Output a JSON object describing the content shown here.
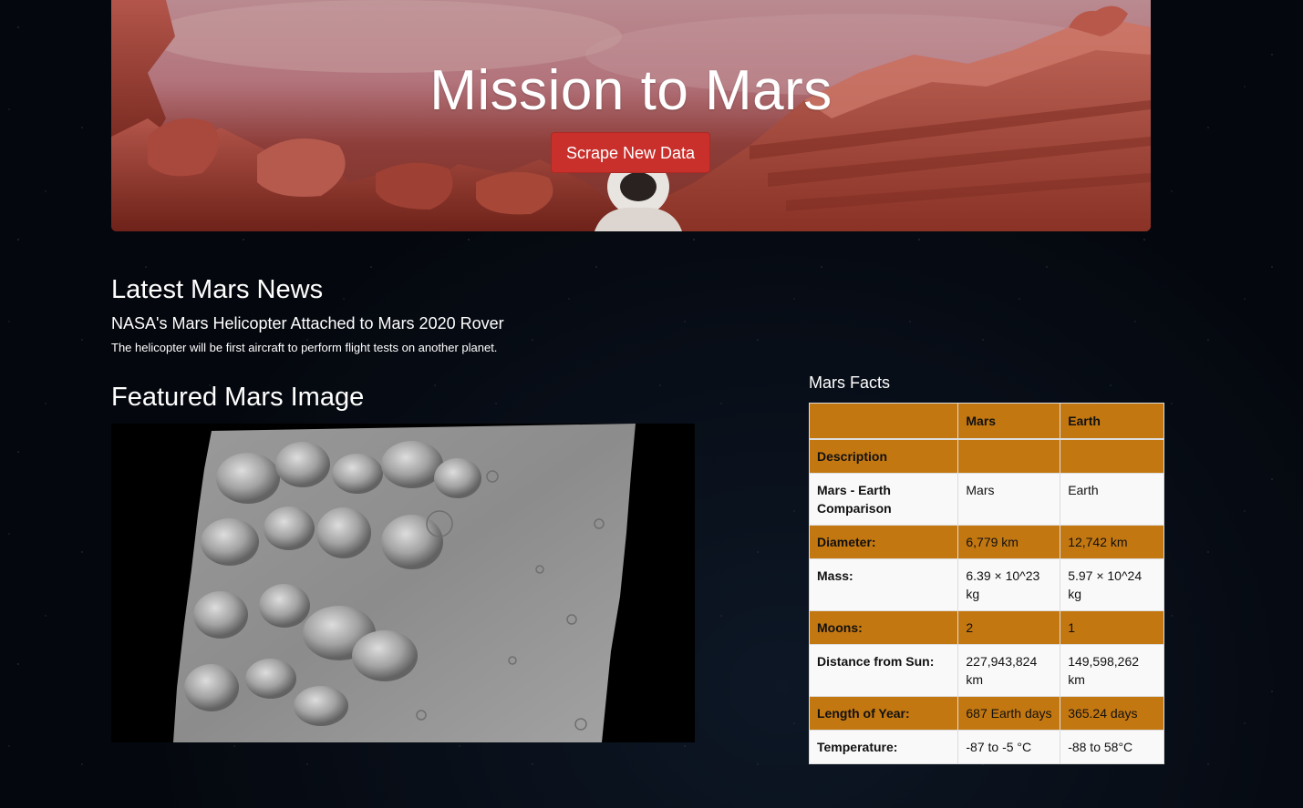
{
  "header": {
    "title": "Mission to Mars",
    "scrape_button": "Scrape New Data"
  },
  "news": {
    "heading": "Latest Mars News",
    "title": "NASA's Mars Helicopter Attached to Mars 2020 Rover",
    "teaser": "The helicopter will be first aircraft to perform flight tests on another planet."
  },
  "featured": {
    "heading": "Featured Mars Image"
  },
  "facts": {
    "heading": "Mars Facts",
    "columns": [
      "",
      "Mars",
      "Earth"
    ],
    "section_label": "Description",
    "rows": [
      {
        "label": "Mars - Earth Comparison",
        "mars": "Mars",
        "earth": "Earth"
      },
      {
        "label": "Diameter:",
        "mars": "6,779 km",
        "earth": "12,742 km"
      },
      {
        "label": "Mass:",
        "mars": "6.39 × 10^23 kg",
        "earth": "5.97 × 10^24 kg"
      },
      {
        "label": "Moons:",
        "mars": "2",
        "earth": "1"
      },
      {
        "label": "Distance from Sun:",
        "mars": "227,943,824 km",
        "earth": "149,598,262 km"
      },
      {
        "label": "Length of Year:",
        "mars": "687 Earth days",
        "earth": "365.24 days"
      },
      {
        "label": "Temperature:",
        "mars": "-87 to -5 °C",
        "earth": "-88 to 58°C"
      }
    ]
  },
  "colors": {
    "button": "#c9302c",
    "table_accent": "#c37711",
    "table_plain": "#f9f9f9",
    "page_background": "#04070d"
  }
}
